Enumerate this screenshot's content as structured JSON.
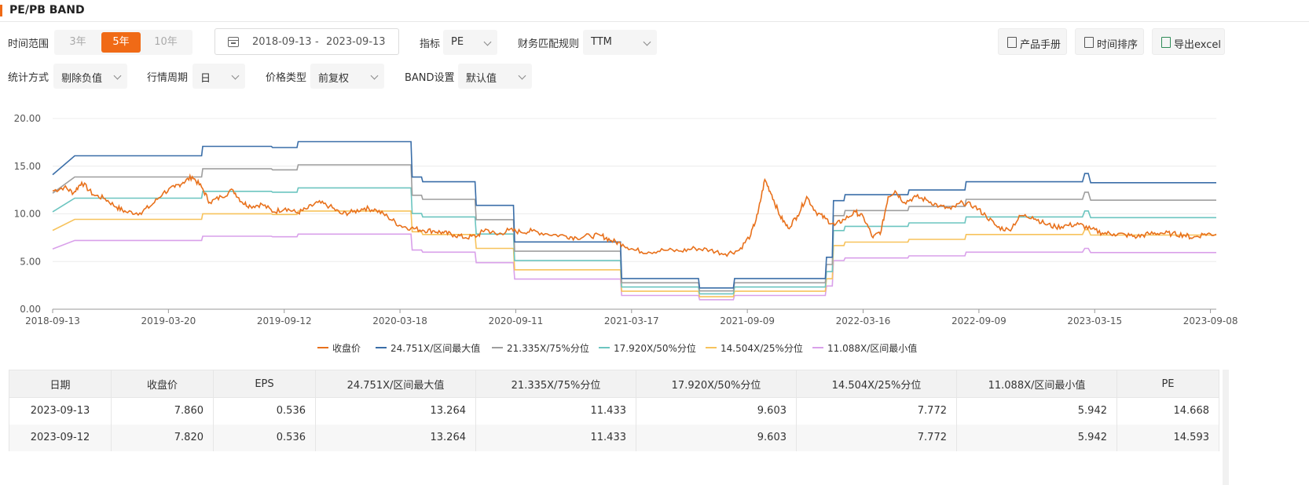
{
  "header": {
    "title": "PE/PB BAND"
  },
  "filters": {
    "time_range_label": "时间范围",
    "time_range_options": [
      "3年",
      "5年",
      "10年"
    ],
    "date_start": "2018-09-13",
    "date_sep": "-",
    "date_end": "2023-09-13",
    "indicator_label": "指标",
    "indicator_value": "PE",
    "finance_rule_label": "财务匹配规则",
    "finance_rule_value": "TTM",
    "stat_method_label": "统计方式",
    "stat_method_value": "剔除负值",
    "period_label": "行情周期",
    "period_value": "日",
    "price_type_label": "价格类型",
    "price_type_value": "前复权",
    "band_label": "BAND设置",
    "band_value": "默认值"
  },
  "toolbar": {
    "manual_label": "产品手册",
    "time_sort_label": "时间排序",
    "export_label": "导出excel"
  },
  "chart_data": {
    "type": "line",
    "ylim": [
      0,
      20
    ],
    "y_ticks": [
      "0.00",
      "5.00",
      "10.00",
      "15.00",
      "20.00"
    ],
    "x_ticks": [
      "2018-09-13",
      "2019-03-20",
      "2019-09-12",
      "2020-03-18",
      "2020-09-11",
      "2021-03-17",
      "2021-09-09",
      "2022-03-16",
      "2022-09-09",
      "2023-03-15",
      "2023-09-08"
    ],
    "grid": true,
    "legend_position": "bottom",
    "colors": {
      "close": "#e8711c",
      "max": "#3a6ea8",
      "p75": "#9e9e9e",
      "p50": "#6cc5c0",
      "p25": "#f7c35c",
      "min": "#d9a0ea"
    },
    "band_multiples": {
      "max": 24.751,
      "p75": 21.335,
      "p50": 17.92,
      "p25": 14.504,
      "min": 11.088
    },
    "eps": [
      [
        0.0,
        0.57
      ],
      [
        0.019,
        0.65
      ],
      [
        0.128,
        0.65
      ],
      [
        0.129,
        0.69
      ],
      [
        0.188,
        0.69
      ],
      [
        0.189,
        0.685
      ],
      [
        0.21,
        0.685
      ],
      [
        0.211,
        0.71
      ],
      [
        0.308,
        0.71
      ],
      [
        0.309,
        0.56
      ],
      [
        0.317,
        0.56
      ],
      [
        0.318,
        0.54
      ],
      [
        0.363,
        0.54
      ],
      [
        0.364,
        0.44
      ],
      [
        0.396,
        0.44
      ],
      [
        0.397,
        0.285
      ],
      [
        0.488,
        0.285
      ],
      [
        0.489,
        0.13
      ],
      [
        0.555,
        0.13
      ],
      [
        0.556,
        0.09
      ],
      [
        0.585,
        0.09
      ],
      [
        0.586,
        0.13
      ],
      [
        0.664,
        0.13
      ],
      [
        0.665,
        0.22
      ],
      [
        0.67,
        0.22
      ],
      [
        0.671,
        0.46
      ],
      [
        0.68,
        0.46
      ],
      [
        0.681,
        0.485
      ],
      [
        0.735,
        0.485
      ],
      [
        0.736,
        0.505
      ],
      [
        0.784,
        0.505
      ],
      [
        0.785,
        0.54
      ],
      [
        0.885,
        0.54
      ],
      [
        0.887,
        0.575
      ],
      [
        0.89,
        0.575
      ],
      [
        0.892,
        0.536
      ],
      [
        1.0,
        0.536
      ]
    ],
    "close": [
      [
        0.0,
        12.4
      ],
      [
        0.01,
        12.8
      ],
      [
        0.018,
        12.2
      ],
      [
        0.025,
        13.3
      ],
      [
        0.035,
        12.0
      ],
      [
        0.045,
        11.6
      ],
      [
        0.055,
        10.7
      ],
      [
        0.063,
        10.2
      ],
      [
        0.075,
        10.1
      ],
      [
        0.085,
        10.9
      ],
      [
        0.095,
        12.2
      ],
      [
        0.105,
        12.8
      ],
      [
        0.112,
        13.3
      ],
      [
        0.12,
        13.9
      ],
      [
        0.128,
        12.8
      ],
      [
        0.135,
        11.2
      ],
      [
        0.145,
        11.8
      ],
      [
        0.155,
        12.5
      ],
      [
        0.163,
        11.2
      ],
      [
        0.17,
        10.8
      ],
      [
        0.18,
        11.0
      ],
      [
        0.19,
        10.2
      ],
      [
        0.2,
        10.6
      ],
      [
        0.21,
        10.1
      ],
      [
        0.218,
        10.5
      ],
      [
        0.228,
        11.2
      ],
      [
        0.238,
        10.8
      ],
      [
        0.248,
        10.0
      ],
      [
        0.258,
        10.2
      ],
      [
        0.268,
        10.6
      ],
      [
        0.278,
        10.4
      ],
      [
        0.288,
        9.7
      ],
      [
        0.298,
        8.8
      ],
      [
        0.308,
        8.5
      ],
      [
        0.318,
        8.3
      ],
      [
        0.328,
        8.2
      ],
      [
        0.336,
        8.0
      ],
      [
        0.345,
        7.8
      ],
      [
        0.355,
        7.5
      ],
      [
        0.365,
        7.7
      ],
      [
        0.372,
        8.4
      ],
      [
        0.382,
        7.8
      ],
      [
        0.392,
        8.3
      ],
      [
        0.402,
        8.1
      ],
      [
        0.412,
        8.2
      ],
      [
        0.425,
        7.9
      ],
      [
        0.44,
        7.7
      ],
      [
        0.45,
        7.5
      ],
      [
        0.462,
        7.7
      ],
      [
        0.472,
        7.7
      ],
      [
        0.48,
        7.2
      ],
      [
        0.49,
        6.8
      ],
      [
        0.5,
        6.2
      ],
      [
        0.512,
        6.0
      ],
      [
        0.525,
        6.2
      ],
      [
        0.54,
        6.1
      ],
      [
        0.552,
        6.4
      ],
      [
        0.565,
        6.2
      ],
      [
        0.578,
        5.8
      ],
      [
        0.59,
        6.2
      ],
      [
        0.6,
        7.8
      ],
      [
        0.606,
        10.0
      ],
      [
        0.612,
        13.6
      ],
      [
        0.618,
        12.0
      ],
      [
        0.625,
        9.8
      ],
      [
        0.632,
        8.5
      ],
      [
        0.64,
        9.8
      ],
      [
        0.648,
        11.8
      ],
      [
        0.656,
        10.2
      ],
      [
        0.664,
        9.5
      ],
      [
        0.672,
        8.8
      ],
      [
        0.68,
        9.4
      ],
      [
        0.69,
        10.2
      ],
      [
        0.697,
        9.6
      ],
      [
        0.705,
        7.5
      ],
      [
        0.712,
        8.2
      ],
      [
        0.718,
        11.8
      ],
      [
        0.724,
        12.4
      ],
      [
        0.732,
        11.2
      ],
      [
        0.742,
        11.8
      ],
      [
        0.752,
        11.4
      ],
      [
        0.762,
        10.8
      ],
      [
        0.772,
        10.5
      ],
      [
        0.782,
        11.2
      ],
      [
        0.792,
        10.8
      ],
      [
        0.802,
        9.8
      ],
      [
        0.812,
        8.6
      ],
      [
        0.822,
        8.3
      ],
      [
        0.832,
        9.8
      ],
      [
        0.842,
        9.7
      ],
      [
        0.852,
        9.0
      ],
      [
        0.862,
        8.6
      ],
      [
        0.872,
        8.8
      ],
      [
        0.882,
        8.9
      ],
      [
        0.892,
        8.4
      ],
      [
        0.902,
        8.0
      ],
      [
        0.912,
        7.9
      ],
      [
        0.922,
        7.8
      ],
      [
        0.932,
        7.6
      ],
      [
        0.942,
        7.9
      ],
      [
        0.952,
        8.0
      ],
      [
        0.962,
        7.9
      ],
      [
        0.972,
        7.8
      ],
      [
        0.98,
        7.5
      ],
      [
        0.99,
        7.9
      ],
      [
        1.0,
        7.86
      ]
    ]
  },
  "legend": [
    {
      "label": "收盘价",
      "key": "close"
    },
    {
      "label": "24.751X/区间最大值",
      "key": "max"
    },
    {
      "label": "21.335X/75%分位",
      "key": "p75"
    },
    {
      "label": "17.920X/50%分位",
      "key": "p50"
    },
    {
      "label": "14.504X/25%分位",
      "key": "p25"
    },
    {
      "label": "11.088X/区间最小值",
      "key": "min"
    }
  ],
  "table": {
    "headers": [
      "日期",
      "收盘价",
      "EPS",
      "24.751X/区间最大值",
      "21.335X/75%分位",
      "17.920X/50%分位",
      "14.504X/25%分位",
      "11.088X/区间最小值",
      "PE"
    ],
    "rows": [
      [
        "2023-09-13",
        "7.860",
        "0.536",
        "13.264",
        "11.433",
        "9.603",
        "7.772",
        "5.942",
        "14.668"
      ],
      [
        "2023-09-12",
        "7.820",
        "0.536",
        "13.264",
        "11.433",
        "9.603",
        "7.772",
        "5.942",
        "14.593"
      ]
    ]
  }
}
